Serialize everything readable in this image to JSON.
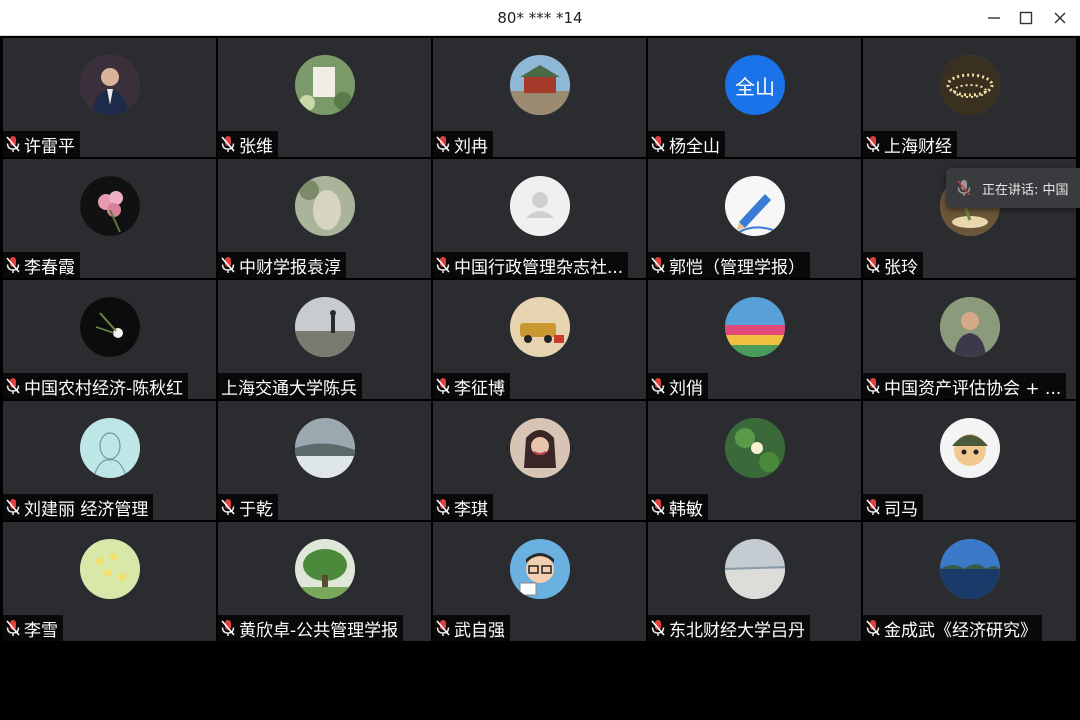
{
  "window": {
    "title": "80* *** *14",
    "controls": [
      "minimize-icon",
      "maximize-icon",
      "close-icon"
    ]
  },
  "speaking_indicator": {
    "text": "正在讲话: 中国",
    "icon": "mic-muted-icon"
  },
  "colors": {
    "tile_bg": "#2b2c2f",
    "mic_red": "#e04040",
    "avatar_text_blue": "#1a73e8"
  },
  "participants": [
    {
      "name": "许雷平",
      "muted": true,
      "avatar": "photo-man-suit"
    },
    {
      "name": "张维",
      "muted": true,
      "avatar": "photo-sign-flowers"
    },
    {
      "name": "刘冉",
      "muted": true,
      "avatar": "photo-temple"
    },
    {
      "name": "杨全山",
      "muted": true,
      "avatar": "text",
      "avatar_text": "全山"
    },
    {
      "name": "上海财经",
      "muted": true,
      "avatar": "photo-chandelier"
    },
    {
      "name": "李春霞",
      "muted": true,
      "avatar": "photo-pink-flower"
    },
    {
      "name": "中财学报袁淳",
      "muted": true,
      "avatar": "photo-statue"
    },
    {
      "name": "中国行政管理杂志社...",
      "muted": true,
      "avatar": "default-user"
    },
    {
      "name": "郭恺（管理学报）",
      "muted": true,
      "avatar": "photo-pencil"
    },
    {
      "name": "张玲",
      "muted": true,
      "avatar": "photo-plant"
    },
    {
      "name": "中国农村经济-陈秋红",
      "muted": true,
      "avatar": "photo-white-flower"
    },
    {
      "name": "上海交通大学陈兵",
      "muted": false,
      "avatar": "photo-pier"
    },
    {
      "name": "李征博",
      "muted": true,
      "avatar": "photo-jeep"
    },
    {
      "name": "刘俏",
      "muted": true,
      "avatar": "photo-colorful-road"
    },
    {
      "name": "中国资产评估协会 + ...",
      "muted": true,
      "avatar": "photo-man-portrait"
    },
    {
      "name": "刘建丽 经济管理",
      "muted": true,
      "avatar": "photo-sketch"
    },
    {
      "name": "于乾",
      "muted": true,
      "avatar": "photo-waterfall"
    },
    {
      "name": "李琪",
      "muted": true,
      "avatar": "photo-woman"
    },
    {
      "name": "韩敏",
      "muted": true,
      "avatar": "photo-lotus"
    },
    {
      "name": "司马",
      "muted": true,
      "avatar": "cartoon-soldier"
    },
    {
      "name": "李雪",
      "muted": true,
      "avatar": "photo-yellow-flowers"
    },
    {
      "name": "黄欣卓-公共管理学报",
      "muted": true,
      "avatar": "photo-tree"
    },
    {
      "name": "武自强",
      "muted": true,
      "avatar": "cartoon-glasses-man"
    },
    {
      "name": "东北财经大学吕丹",
      "muted": true,
      "avatar": "photo-sea"
    },
    {
      "name": "金成武《经济研究》",
      "muted": true,
      "avatar": "photo-lake"
    }
  ]
}
